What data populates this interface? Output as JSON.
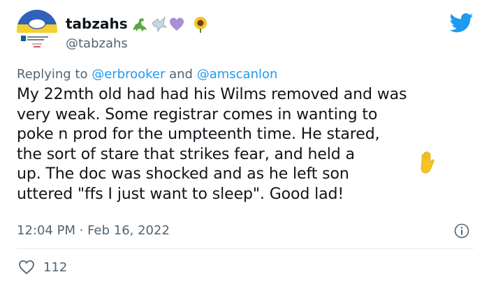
{
  "user": {
    "display_name": "tabzahs",
    "handle": "@tabzahs",
    "emoji_names": [
      "dinosaur-emoji",
      "dove-emoji",
      "purple-heart-emoji",
      "sunflower-emoji"
    ]
  },
  "reply": {
    "prefix": "Replying to ",
    "mention1": "@erbrooker",
    "joiner": " and ",
    "mention2": "@amscanlon"
  },
  "tweet": {
    "text_part1": "My 22mth old had had his Wilms removed and was\nvery weak. Some registrar comes in wanting to\npoke n prod for the umpteenth time. He stared,\nthe sort of stare that strikes fear, and held a",
    "text_part2": " up. The doc was shocked and as he left son\nuttered \"ffs I just want to sleep\". Good lad!",
    "inline_emoji": "raised-hand-emoji"
  },
  "meta": {
    "time": "12:04 PM",
    "separator": " · ",
    "date": "Feb 16, 2022"
  },
  "engagement": {
    "likes": "112"
  },
  "colors": {
    "link": "#1d9bf0",
    "secondary_text": "#536471",
    "twitter_blue": "#1d9bf0",
    "divider": "#e6ecf0"
  }
}
